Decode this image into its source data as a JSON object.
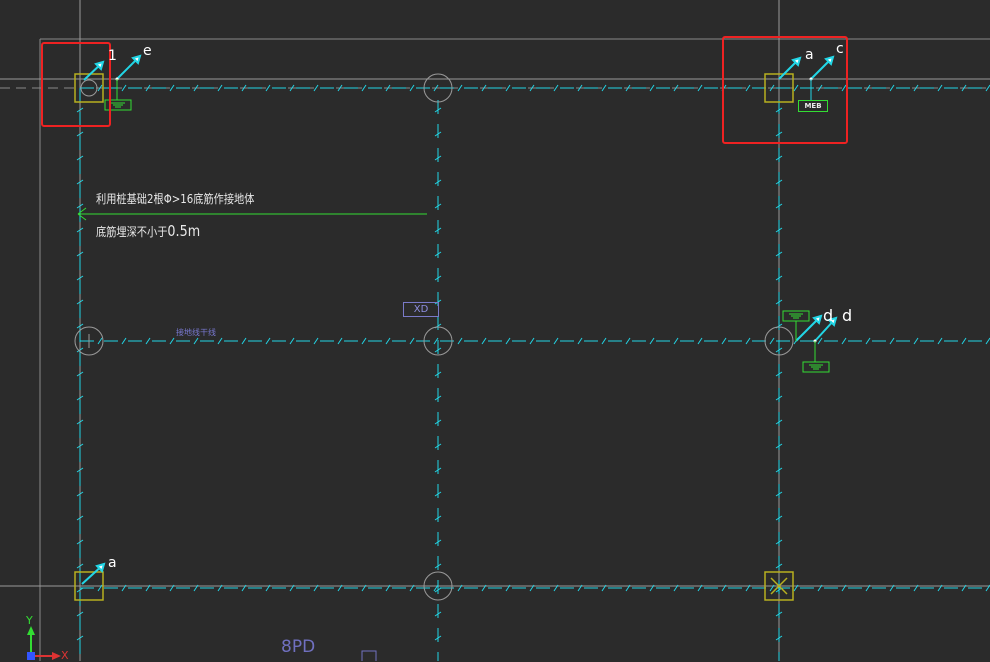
{
  "notes": {
    "line1": "利用桩基础2根Φ>16底筋作接地体",
    "line2_prefix": "底筋埋深不小于",
    "line2_value": "0.5m"
  },
  "tags": {
    "xd": "XD",
    "meb": "MEB",
    "label_8pd": "8PD",
    "mid_note": "接地线干线"
  },
  "letters": {
    "top_left_1": "1",
    "top_left_2": "e",
    "top_right_1": "a",
    "top_right_2": "c",
    "mid_right_1": "d",
    "mid_right_2": "d",
    "bottom_left": "a"
  },
  "axis": {
    "y": "Y",
    "x": "X"
  },
  "colors": {
    "background": "#2b2b2b",
    "grid": "#9a9a9a",
    "cyan": "#22d6e6",
    "highlight": "#ee2222",
    "column": "#b8b020",
    "ground": "#33dd33",
    "leader": "#33dd33"
  }
}
